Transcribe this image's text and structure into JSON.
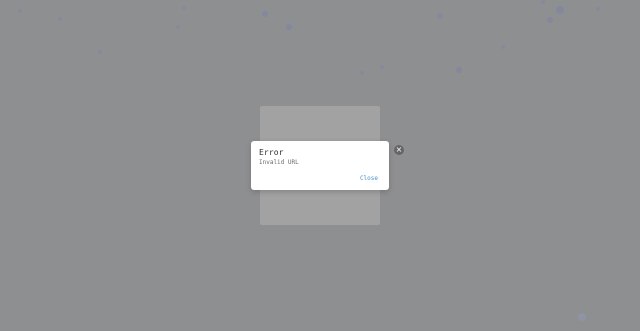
{
  "dialog": {
    "title": "Error",
    "message": "Invalid URL",
    "close_label": "Close"
  },
  "close_icon": "×"
}
